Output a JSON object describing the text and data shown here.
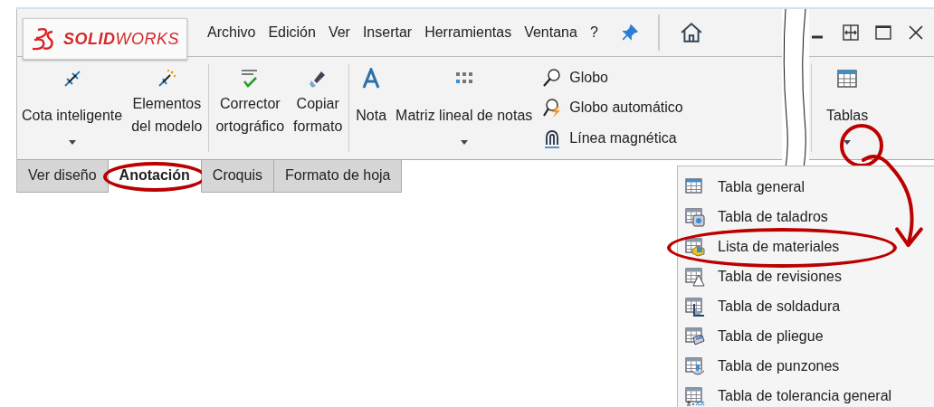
{
  "app": {
    "logo": "**SOLID**WORKS"
  },
  "menu": [
    "Archivo",
    "Edición",
    "Ver",
    "Insertar",
    "Herramientas",
    "Ventana",
    "?"
  ],
  "ribbon_groups": [
    {
      "buttons": [
        {
          "lines": [
            "Cota inteligente"
          ],
          "kind": "dimension",
          "caret": true
        },
        {
          "lines": [
            "Elementos",
            "del modelo"
          ],
          "kind": "model-items",
          "caret": false
        }
      ]
    },
    {
      "buttons": [
        {
          "lines": [
            "Corrector",
            "ortográfico"
          ],
          "kind": "spell",
          "caret": false
        },
        {
          "lines": [
            "Copiar",
            "formato"
          ],
          "kind": "brush",
          "caret": false
        }
      ]
    },
    {
      "buttons": [
        {
          "lines": [
            "Nota"
          ],
          "kind": "note",
          "caret": false
        },
        {
          "lines": [
            "Matriz lineal de notas"
          ],
          "kind": "pattern",
          "caret": true
        }
      ],
      "small": [
        {
          "label": "Globo",
          "kind": "balloon"
        },
        {
          "label": "Globo automático",
          "kind": "auto-balloon"
        },
        {
          "label": "Línea magnética",
          "kind": "magnet"
        }
      ]
    }
  ],
  "tables_button": {
    "label": "Tablas",
    "circled": true
  },
  "tabs": [
    {
      "label": "Ver diseño",
      "selected": false,
      "circled": false
    },
    {
      "label": "Anotación",
      "selected": true,
      "circled": true
    },
    {
      "label": "Croquis",
      "selected": false,
      "circled": false
    },
    {
      "label": "Formato de hoja",
      "selected": false,
      "circled": false
    }
  ],
  "dropdown": [
    {
      "label": "Tabla general",
      "kind": "table",
      "circled": false
    },
    {
      "label": "Tabla de taladros",
      "kind": "hole",
      "circled": false
    },
    {
      "label": "Lista de materiales",
      "kind": "bom",
      "circled": true
    },
    {
      "label": "Tabla de revisiones",
      "kind": "revision",
      "circled": false
    },
    {
      "label": "Tabla de soldadura",
      "kind": "weld",
      "circled": false
    },
    {
      "label": "Tabla de pliegue",
      "kind": "bend",
      "circled": false
    },
    {
      "label": "Tabla de punzones",
      "kind": "punch",
      "circled": false
    },
    {
      "label": "Tabla de tolerancia general",
      "kind": "tolerance",
      "circled": false
    }
  ]
}
